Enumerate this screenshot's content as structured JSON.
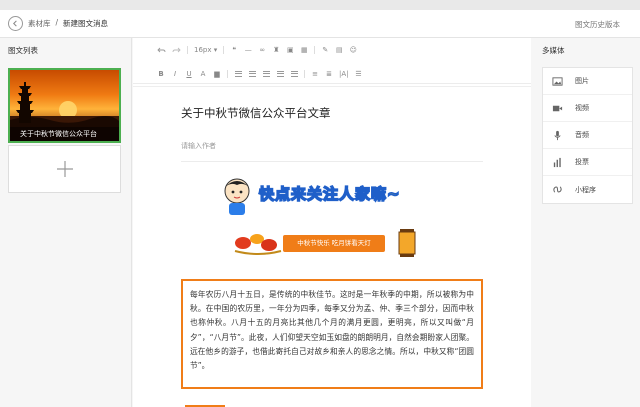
{
  "header": {
    "breadcrumb_root": "素材库",
    "breadcrumb_sep": "/",
    "breadcrumb_current": "新建图文消息",
    "history_link": "图文历史版本"
  },
  "left_panel": {
    "title": "图文列表",
    "articles": [
      {
        "caption": "关于中秋节微信公众平台"
      }
    ]
  },
  "toolbar": {
    "font_size": "16px",
    "font_size_caret": "▾",
    "bold": "B",
    "italic": "I",
    "underline": "U",
    "font_color": "A"
  },
  "document": {
    "title": "关于中秋节微信公众平台文章",
    "author_placeholder": "请输入作者",
    "banner_text": "快点来关注人家嘛~",
    "festival_pill": "中秋节快乐 吃月饼看天灯",
    "paragraph": "每年农历八月十五日，是传统的中秋佳节。这时是一年秋季的中期，所以被称为中秋。在中国的农历里，一年分为四季，每季又分为孟、仲、季三个部分，因而中秋也称仲秋。八月十五的月亮比其他几个月的满月更圆，更明亮，所以又叫做“月夕”，“八月节”。此夜，人们仰望天空如玉如盘的朗朗明月，自然会期盼家人团聚。远在他乡的游子，也借此寄托自己对故乡和亲人的思念之情。所以，中秋又称“团圆节”。"
  },
  "right_panel": {
    "title": "多媒体",
    "items": [
      {
        "label": "图片",
        "icon": "image-icon"
      },
      {
        "label": "视频",
        "icon": "video-icon"
      },
      {
        "label": "音频",
        "icon": "microphone-icon"
      },
      {
        "label": "投票",
        "icon": "bar-chart-icon"
      },
      {
        "label": "小程序",
        "icon": "mini-program-icon"
      }
    ]
  },
  "colors": {
    "accent_green": "#4caf50",
    "accent_orange": "#f07d18",
    "banner_yellow": "#ffe32b",
    "banner_blue": "#1f5fc9"
  }
}
